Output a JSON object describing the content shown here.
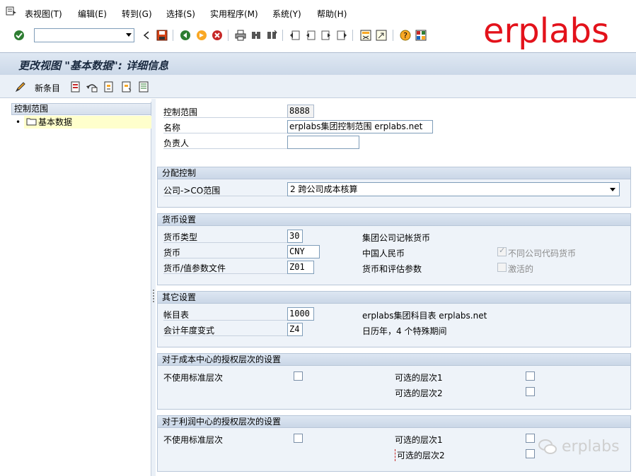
{
  "menu": {
    "items": [
      "表视图(T)",
      "编辑(E)",
      "转到(G)",
      "选择(S)",
      "实用程序(M)",
      "系统(Y)",
      "帮助(H)"
    ]
  },
  "toolbar": {
    "command_field_value": "",
    "icons": [
      "enter-icon",
      "save-icon",
      "back-icon",
      "exit-icon",
      "cancel-icon",
      "print-icon",
      "find-icon",
      "find-next-icon",
      "first-page-icon",
      "prev-page-icon",
      "next-page-icon",
      "last-page-icon",
      "new-session-icon",
      "shortcut-icon",
      "help-icon",
      "layout-icon"
    ]
  },
  "brand": "erplabs",
  "title": "更改视图 \"基本数据\": 详细信息",
  "app_toolbar": {
    "new_entries_label": "新条目"
  },
  "nav": {
    "header": "控制范围",
    "items": [
      {
        "label": "基本数据"
      }
    ]
  },
  "header_fields": {
    "controlling_area_label": "控制范围",
    "controlling_area_value": "8888",
    "name_label": "名称",
    "name_value": "erplabs集团控制范围 erplabs.net",
    "person_label": "负责人",
    "person_value": ""
  },
  "assignment": {
    "title": "分配控制",
    "company_co_label": "公司->CO范围",
    "company_co_value": "2 跨公司成本核算"
  },
  "currency": {
    "title": "货币设置",
    "curr_type_label": "货币类型",
    "curr_type_value": "30",
    "curr_type_desc": "集团公司记帐货币",
    "curr_label": "货币",
    "curr_value": "CNY",
    "curr_desc": "中国人民币",
    "curr_profile_label": "货币/值参数文件",
    "curr_profile_value": "Z01",
    "curr_profile_desc": "货币和评估参数",
    "diff_cc_curr_label": "不同公司代码货币",
    "diff_cc_curr_checked": true,
    "active_label": "激活的",
    "active_checked": false
  },
  "other": {
    "title": "其它设置",
    "coa_label": "帐目表",
    "coa_value": "1000",
    "coa_desc": "erplabs集团科目表 erplabs.net",
    "fyv_label": "会计年度变式",
    "fyv_value": "Z4",
    "fyv_desc": "日历年，4 个特殊期间"
  },
  "cc_hierarchy": {
    "title": "对于成本中心的授权层次的设置",
    "no_std_label": "不使用标准层次",
    "alt1_label": "可选的层次1",
    "alt2_label": "可选的层次2"
  },
  "pc_hierarchy": {
    "title": "对于利润中心的授权层次的设置",
    "no_std_label": "不使用标准层次",
    "alt1_label": "可选的层次1",
    "alt2_label": "可选的层次2"
  },
  "watermark": "erplabs"
}
